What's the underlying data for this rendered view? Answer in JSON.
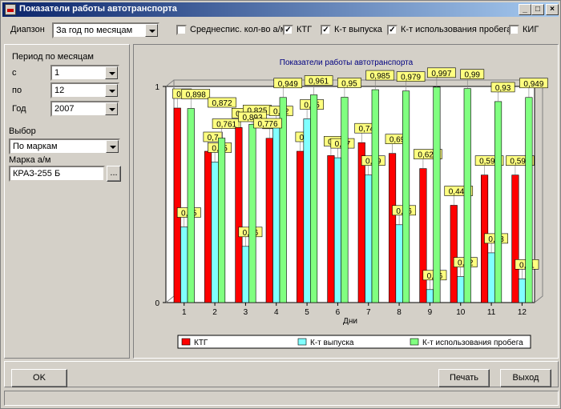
{
  "window": {
    "title": "Показатели работы автотранспорта"
  },
  "toolbar": {
    "range_label": "Диапзон",
    "range_value": "За год по месяцам",
    "checks": [
      {
        "label": "Среднеспис. кол-во а/м",
        "checked": false
      },
      {
        "label": "КТГ",
        "checked": true
      },
      {
        "label": "К-т выпуска",
        "checked": true
      },
      {
        "label": "К-т использования пробега",
        "checked": true
      },
      {
        "label": "КИГ",
        "checked": false
      }
    ]
  },
  "left": {
    "period_label": "Период по месяцам",
    "from_label": "с",
    "from_value": "1",
    "to_label": "по",
    "to_value": "12",
    "year_label": "Год",
    "year_value": "2007",
    "choice_label": "Выбор",
    "choice_value": "По маркам",
    "brand_label": "Марка а/м",
    "brand_value": "КРАЗ-255 Б",
    "browse_label": "..."
  },
  "buttons": {
    "ok": "OK",
    "print": "Печать",
    "exit": "Выход"
  },
  "colors": {
    "ktg": "#ff0000",
    "release": "#80ffff",
    "mileage": "#80ff80",
    "label_bg": "#ffff80",
    "title": "#000080"
  },
  "chart_data": {
    "type": "bar",
    "title": "Показатели работы автотранспорта",
    "xlabel": "Дни",
    "ylabel": "",
    "ylim": [
      0,
      1
    ],
    "yticks": [
      "0",
      "1"
    ],
    "categories": [
      "1",
      "2",
      "3",
      "4",
      "5",
      "6",
      "7",
      "8",
      "9",
      "10",
      "11",
      "12"
    ],
    "series": [
      {
        "name": "КТГ",
        "color": "#ff0000",
        "values": [
          0.9,
          0.7,
          0.81,
          0.76,
          0.7,
          0.68,
          0.74,
          0.69,
          0.62,
          0.45,
          0.59,
          0.59
        ],
        "labels": [
          "0,9",
          "0,7",
          "0,81",
          "0,76",
          "0,7",
          "0,68",
          "0,74",
          "0,69",
          "0,625",
          "0,446",
          "0,594",
          "0,593"
        ]
      },
      {
        "name": "К-т выпуска",
        "color": "#80ffff",
        "values": [
          0.35,
          0.65,
          0.26,
          0.82,
          0.85,
          0.67,
          0.59,
          0.36,
          0.06,
          0.12,
          0.23,
          0.11
        ],
        "labels": [
          "0,35",
          "0,65",
          "0,26",
          "0,82",
          "0,85",
          "0,67",
          "0,59",
          "0,36",
          "0,06",
          "0,12",
          "0,23",
          "0,11"
        ]
      },
      {
        "name": "К-т использования пробега",
        "color": "#80ff80",
        "values": [
          0.898,
          0.761,
          0.825,
          0.949,
          0.961,
          0.95,
          0.985,
          0.979,
          0.997,
          0.99,
          0.93,
          0.949
        ],
        "labels": [
          "0,898",
          "0,761",
          "0,825",
          "0,949",
          "0,961",
          "0,95",
          "0,985",
          "0,979",
          "0,997",
          "0,99",
          "0,93",
          "0,949"
        ]
      }
    ],
    "extra_labels": [
      "0,872",
      "0,893",
      "0,776"
    ],
    "legend": "bottom",
    "grid": false
  }
}
